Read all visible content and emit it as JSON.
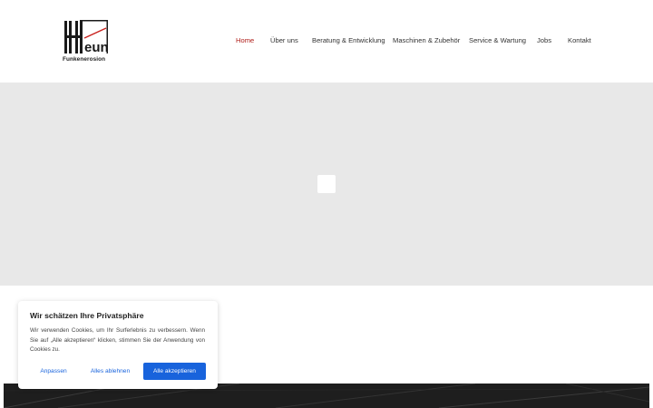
{
  "logo": {
    "mark_text": "eun",
    "subtitle": "Funkenerosion"
  },
  "nav": {
    "items": [
      {
        "label": "Home",
        "active": true
      },
      {
        "label": "Über uns",
        "active": false
      },
      {
        "label": "Beratung & Entwicklung",
        "active": false
      },
      {
        "label": "Maschinen & Zubehör",
        "active": false
      },
      {
        "label": "Service & Wartung",
        "active": false
      },
      {
        "label": "Jobs",
        "active": false
      },
      {
        "label": "Kontakt",
        "active": false
      }
    ]
  },
  "cookie": {
    "title": "Wir schätzen Ihre Privatsphäre",
    "text": "Wir verwenden Cookies, um Ihr Surferlebnis zu verbessern. Wenn Sie auf „Alle akzeptieren“ klicken, stimmen Sie der Anwendung von Cookies zu.",
    "customize_label": "Anpassen",
    "reject_label": "Alles ablehnen",
    "accept_label": "Alle akzeptieren"
  },
  "colors": {
    "accent": "#b0201c",
    "button_blue": "#1863dc",
    "hero_bg": "#e8e8e8",
    "dark_band": "#1e1e1e"
  }
}
